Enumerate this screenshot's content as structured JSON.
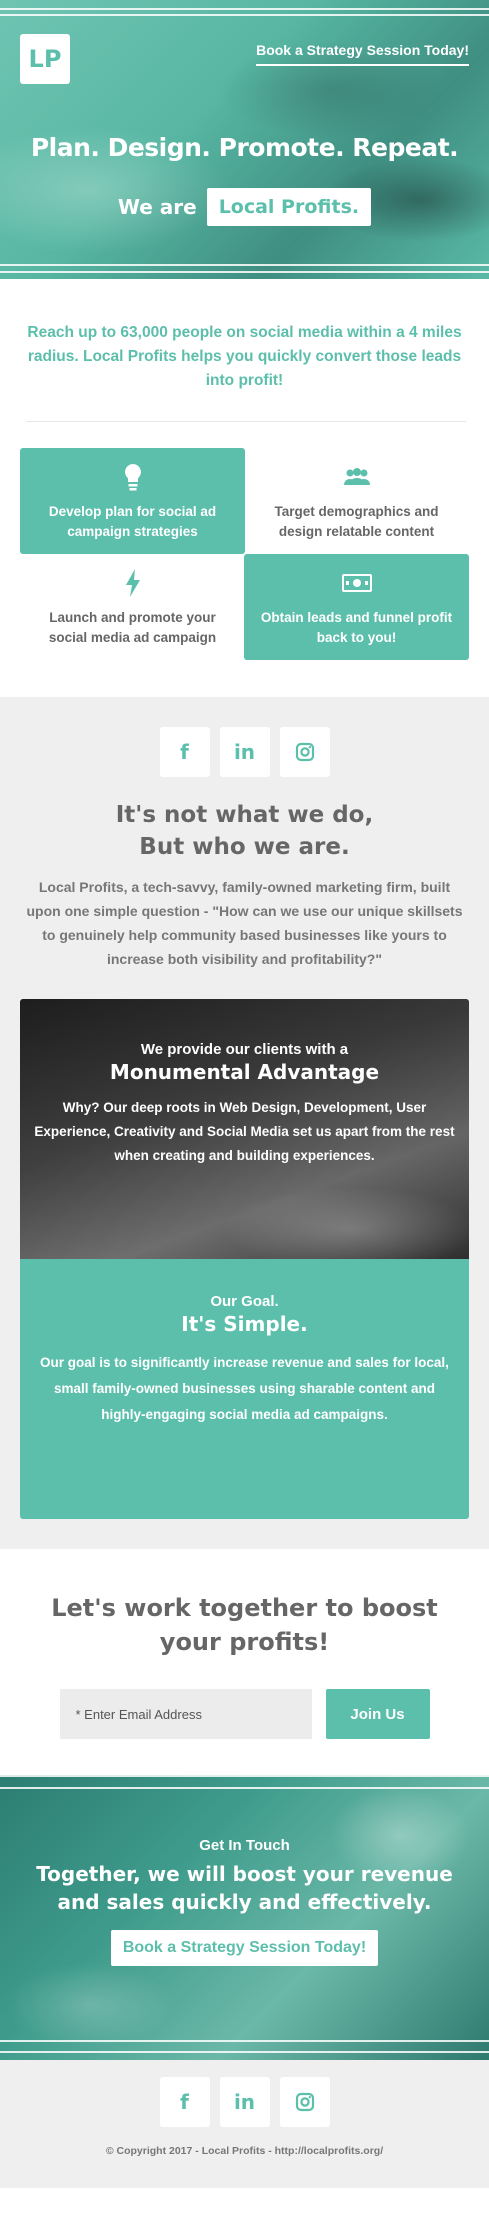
{
  "hero": {
    "logo_text": "LP",
    "cta_link": "Book a Strategy Session Today!",
    "headline": "Plan. Design. Promote. Repeat.",
    "we_are": "We are",
    "brand": "Local Profits."
  },
  "intro": {
    "text": "Reach up to 63,000 people on social media within a 4 miles radius. Local Profits helps you quickly convert those leads into profit!"
  },
  "features": [
    {
      "label": "Develop plan for social ad campaign strategies",
      "icon": "lightbulb-icon"
    },
    {
      "label": "Target demographics and design relatable content",
      "icon": "group-icon"
    },
    {
      "label": "Launch and promote your social media ad campaign",
      "icon": "lightning-icon"
    },
    {
      "label": "Obtain leads and funnel profit back to you!",
      "icon": "money-icon"
    }
  ],
  "social": {
    "facebook": "f",
    "linkedin": "in",
    "instagram": "instagram-icon"
  },
  "about": {
    "heading_line1": "It's not what we do,",
    "heading_line2": "But who we are.",
    "text": "Local Profits, a tech-savvy, family-owned marketing firm, built upon one simple question - \"How can we use our unique skillsets to genuinely help community based businesses like yours to increase both visibility and profitability?\""
  },
  "advantage": {
    "small": "We provide our clients with a",
    "big": "Monumental Advantage",
    "text": "Why? Our deep roots in Web Design, Development, User Experience, Creativity and Social Media set us apart from the rest when creating and building experiences."
  },
  "goal": {
    "small": "Our Goal.",
    "big": "It's Simple.",
    "text": "Our goal is to significantly increase revenue and sales for local, small family-owned businesses using sharable content and highly-engaging social media ad campaigns."
  },
  "signup": {
    "heading": "Let's work together to boost your profits!",
    "placeholder": "* Enter Email Address",
    "button": "Join Us"
  },
  "contact": {
    "small": "Get In Touch",
    "big": "Together, we will boost your revenue and sales quickly and effectively.",
    "button": "Book a Strategy Session Today!"
  },
  "footer": {
    "copyright": "© Copyright 2017 - Local Profits - http://localprofits.org/"
  },
  "colors": {
    "accent": "#5cbfab",
    "text": "#666666",
    "light_bg": "#efefef"
  }
}
